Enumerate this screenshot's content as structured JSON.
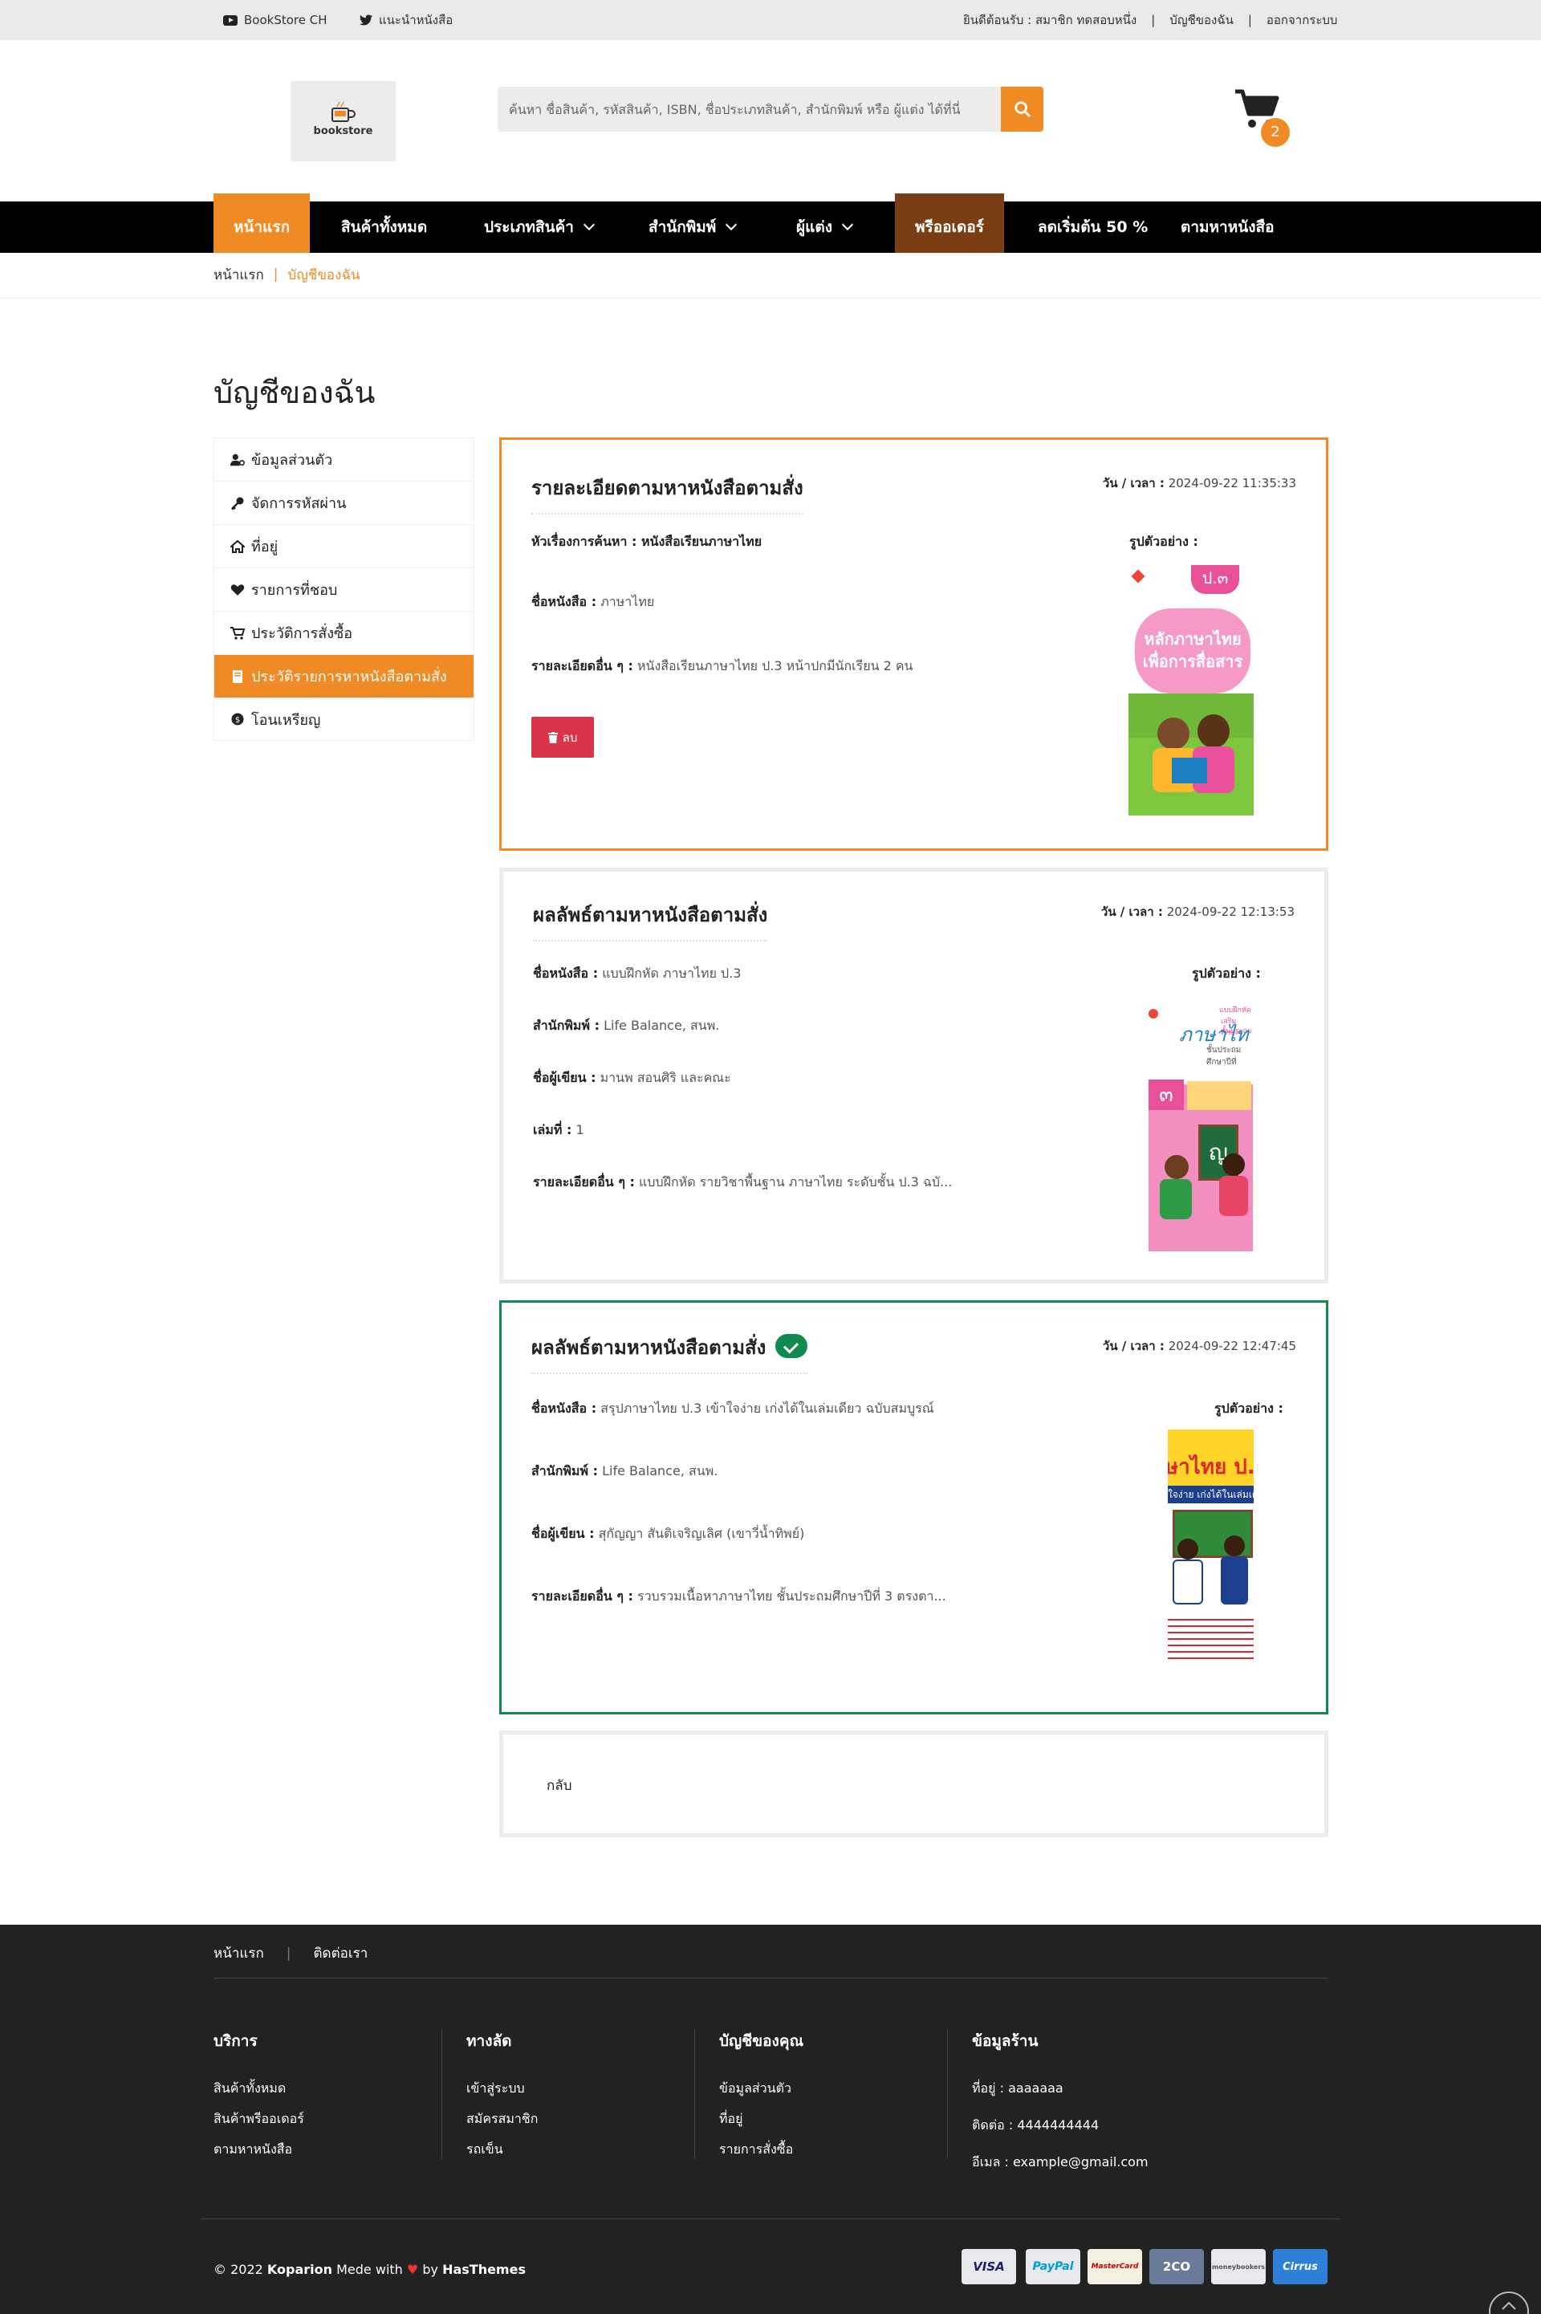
{
  "topbar": {
    "youtube": "BookStore CH",
    "twitter": "แนะนำหนังสือ",
    "welcome": "ยินดีต้อนรับ : สมาชิก ทดสอบหนึ่ง",
    "my_account": "บัญชีของฉัน",
    "logout": "ออกจากระบบ"
  },
  "header": {
    "logo_text": "bookstore",
    "search_placeholder": "ค้นหา ชื่อสินค้า, รหัสสินค้า, ISBN, ชื่อประเภทสินค้า, สำนักพิมพ์ หรือ ผู้แต่ง ได้ที่นี่",
    "cart_count": "2"
  },
  "nav": {
    "items": [
      "หน้าแรก",
      "สินค้าทั้งหมด",
      "ประเภทสินค้า",
      "สำนักพิมพ์",
      "ผู้แต่ง",
      "พรีออเดอร์",
      "ลดเริ่มต้น 50 %",
      "ตามหาหนังสือ"
    ]
  },
  "breadcrumb": {
    "home": "หน้าแรก",
    "current": "บัญชีของฉัน"
  },
  "page_title": "บัญชีของฉัน",
  "sidebar": {
    "items": [
      "ข้อมูลส่วนตัว",
      "จัดการรหัสผ่าน",
      "ที่อยู่",
      "รายการที่ชอบ",
      "ประวัติการสั่งซื้อ",
      "ประวัติรายการหาหนังสือตามสั่ง",
      "โอนเหรียญ"
    ]
  },
  "card1": {
    "title": "รายละเอียดตามหาหนังสือตามสั่ง",
    "datetime_label": "วัน / เวลา :",
    "datetime": "2024-09-22 11:35:33",
    "subject_label": "หัวเรื่องการค้นหา :",
    "subject": "หนังสือเรียนภาษาไทย",
    "book_label": "ชื่อหนังสือ :",
    "book": "ภาษาไทย",
    "detail_label": "รายละเอียดอื่น ๆ :",
    "detail": "หนังสือเรียนภาษาไทย ป.3 หน้าปกมีนักเรียน 2 คน",
    "image_label": "รูปตัวอย่าง :",
    "delete_label": "ลบ",
    "cover_grade": "ป.๓",
    "cover_line1": "หลักภาษาไทย",
    "cover_line2": "เพื่อการสื่อสาร"
  },
  "card2": {
    "title": "ผลลัพธ์ตามหาหนังสือตามสั่ง",
    "datetime_label": "วัน / เวลา :",
    "datetime": "2024-09-22 12:13:53",
    "book_label": "ชื่อหนังสือ :",
    "book": "แบบฝึกหัด ภาษาไทย ป.3",
    "publisher_label": "สำนักพิมพ์ :",
    "publisher": "Life Balance, สนพ.",
    "author_label": "ชื่อผู้เขียน :",
    "author": "มานพ สอนศิริ และคณะ",
    "volume_label": "เล่มที่ :",
    "volume": "1",
    "detail_label": "รายละเอียดอื่น ๆ :",
    "detail": "แบบฝึกหัด รายวิชาพื้นฐาน ภาษาไทย ระดับชั้น ป.3 ฉบั...",
    "image_label": "รูปตัวอย่าง :",
    "cover_title": "ภาษาไท",
    "cover_num": "๓",
    "cover_board": "ญ"
  },
  "card3": {
    "title": "ผลลัพธ์ตามหาหนังสือตามสั่ง",
    "datetime_label": "วัน / เวลา :",
    "datetime": "2024-09-22 12:47:45",
    "book_label": "ชื่อหนังสือ :",
    "book": "สรุปภาษาไทย ป.3 เข้าใจง่าย เก่งได้ในเล่มเดียว ฉบับสมบูรณ์",
    "publisher_label": "สำนักพิมพ์ :",
    "publisher": "Life Balance, สนพ.",
    "author_label": "ชื่อผู้เขียน :",
    "author": "สุกัญญา สันติเจริญเลิศ (เขาวี่น้ำทิพย์)",
    "detail_label": "รายละเอียดอื่น ๆ :",
    "detail": "รวบรวมเนื้อหาภาษาไทย ชั้นประถมศึกษาปีที่ 3 ตรงตา...",
    "image_label": "รูปตัวอย่าง :",
    "cover_title": "ษาไทย ป.",
    "cover_sub": "ใจง่าย เก่งได้ในเล่มเดี"
  },
  "card4": {
    "back_label": "กลับ"
  },
  "footer": {
    "links": [
      "หน้าแรก",
      "ติดต่อเรา"
    ],
    "col1": {
      "title": "บริการ",
      "items": [
        "สินค้าทั้งหมด",
        "สินค้าพรีออเดอร์",
        "ตามหาหนังสือ"
      ]
    },
    "col2": {
      "title": "ทางลัด",
      "items": [
        "เข้าสู่ระบบ",
        "สมัครสมาชิก",
        "รถเข็น"
      ]
    },
    "col3": {
      "title": "บัญชีของคุณ",
      "items": [
        "ข้อมูลส่วนตัว",
        "ที่อยู่",
        "รายการสั่งซื้อ"
      ]
    },
    "col4": {
      "title": "ข้อมูลร้าน",
      "items": [
        "ที่อยู่ : aaaaaaa",
        "ติดต่อ : 4444444444",
        "อีเมล : example@gmail.com"
      ]
    },
    "copyright_prefix": "© 2022",
    "brand": "Koparion",
    "made_with": "Mede with",
    "by": "by",
    "author": "HasThemes",
    "payments": [
      "VISA",
      "PayPal",
      "MasterCard",
      "2CO",
      "moneybookers",
      "Cirrus"
    ]
  },
  "colors": {
    "accent": "#f08a24",
    "success": "#128a4f",
    "danger": "#d9344b",
    "nav_bg": "#000000",
    "footer_bg": "#222222"
  }
}
